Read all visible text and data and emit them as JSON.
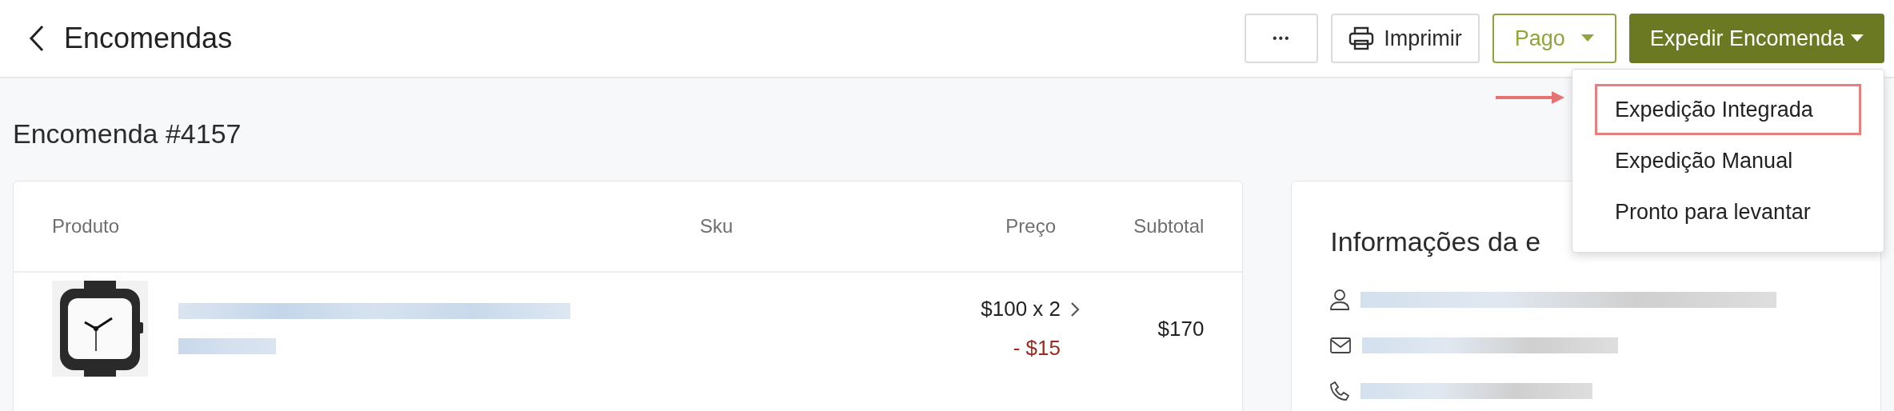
{
  "header": {
    "back_title": "Encomendas",
    "buttons": [
      {
        "kind": "more",
        "label": "•••"
      },
      {
        "kind": "print",
        "label": "Imprimir"
      },
      {
        "kind": "outline_dropdown",
        "label": "Pago"
      },
      {
        "kind": "primary_dropdown",
        "label": "Expedir Encomenda",
        "expanded": true
      }
    ]
  },
  "dropdown_menu": {
    "items": [
      {
        "label": "Expedição Integrada",
        "highlighted": true
      },
      {
        "label": "Expedição Manual",
        "highlighted": false
      },
      {
        "label": "Pronto para levantar",
        "highlighted": false
      }
    ]
  },
  "page_title": "Encomenda #4157",
  "products_table": {
    "columns": [
      "Produto",
      "Sku",
      "Preço",
      "Subtotal"
    ],
    "rows": [
      {
        "price": "$100 x 2",
        "discount": "- $15",
        "subtotal": "$170"
      }
    ]
  },
  "info_card": {
    "title": "Informações da e",
    "rows": [
      {
        "kind": "person"
      },
      {
        "kind": "email"
      },
      {
        "kind": "phone"
      }
    ]
  }
}
